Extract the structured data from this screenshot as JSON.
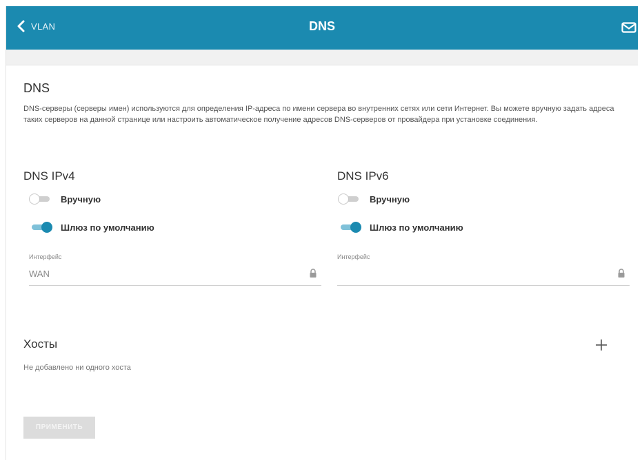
{
  "header": {
    "back_label": "VLAN",
    "title": "DNS"
  },
  "section": {
    "title": "DNS",
    "description": "DNS-серверы (серверы имен) используются для определения IP-адреса по имени сервера во внутренних сетях или сети Интернет. Вы можете вручную задать адреса таких серверов на данной странице или настроить автоматическое получение адресов DNS-серверов от провайдера при установке соединения."
  },
  "ipv4": {
    "title": "DNS IPv4",
    "manual_label": "Вручную",
    "manual_on": false,
    "gateway_label": "Шлюз по умолчанию",
    "gateway_on": true,
    "interface_label": "Интерфейс",
    "interface_value": "WAN"
  },
  "ipv6": {
    "title": "DNS IPv6",
    "manual_label": "Вручную",
    "manual_on": false,
    "gateway_label": "Шлюз по умолчанию",
    "gateway_on": true,
    "interface_label": "Интерфейс",
    "interface_value": ""
  },
  "hosts": {
    "title": "Хосты",
    "empty_text": "Не добавлено ни одного хоста"
  },
  "apply_label": "ПРИМЕНИТЬ",
  "colors": {
    "accent": "#1b8ab0",
    "toggle_track_on": "#7fc1d9",
    "toggle_off": "#cfcfcf",
    "button_disabled": "#dcdcdc"
  },
  "icons": {
    "back": "chevron-left-icon",
    "mail": "mail-icon",
    "lock": "lock-icon",
    "add": "plus-icon"
  }
}
